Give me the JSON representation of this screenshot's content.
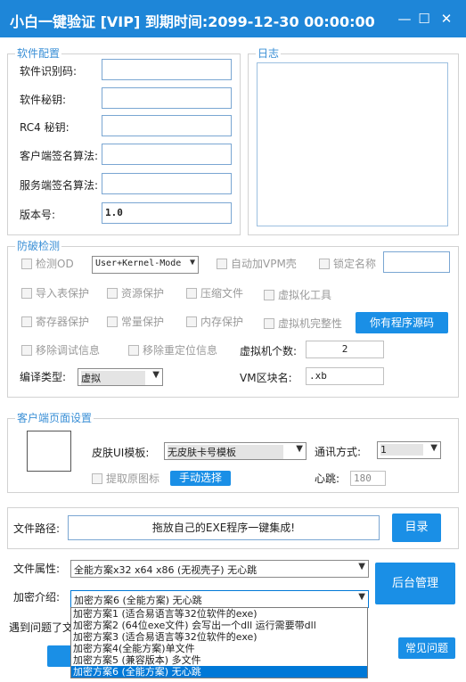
{
  "window": {
    "title": "小白一键验证 [VIP]  到期时间:2099-12-30 00:00:00",
    "minimize_glyph": "—",
    "maximize_glyph": "☐",
    "close_glyph": "✕"
  },
  "software_config": {
    "legend": "软件配置",
    "fields": [
      {
        "label": "软件识别码:",
        "value": ""
      },
      {
        "label": "软件秘钥:",
        "value": ""
      },
      {
        "label": "RC4 秘钥:",
        "value": ""
      },
      {
        "label": "客户端签名算法:",
        "value": ""
      },
      {
        "label": "服务端签名算法:",
        "value": ""
      },
      {
        "label": "版本号:",
        "value": "1.0"
      }
    ]
  },
  "log": {
    "legend": "日志"
  },
  "protection": {
    "legend": "防破检测",
    "detect_od": "检测OD",
    "mode_select": "User+Kernel-Mode",
    "auto_vmp": "自动加VPM壳",
    "lock_name": "锁定名称",
    "lock_name_value": "",
    "import_protect": "导入表保护",
    "resource_protect": "资源保护",
    "compress_file": "压缩文件",
    "virtualize_tool": "虚拟化工具",
    "register_protect": "寄存器保护",
    "constant_protect": "常量保护",
    "memory_protect": "内存保护",
    "vm_integrity": "虚拟机完整性",
    "source_button": "你有程序源码",
    "remove_debug": "移除调试信息",
    "remove_reloc": "移除重定位信息",
    "vm_count_label": "虚拟机个数:",
    "vm_count_value": "2",
    "compile_type_label": "编译类型:",
    "compile_type_value": "虚拟",
    "vm_section_label": "VM区块名:",
    "vm_section_value": ".xb"
  },
  "client_ui": {
    "legend": "客户端页面设置",
    "skin_label": "皮肤UI模板:",
    "skin_value": "无皮肤卡号模板",
    "comm_label": "通讯方式:",
    "comm_value": "1",
    "extract_icon": "提取原图标",
    "manual_select": "手动选择",
    "heartbeat_label": "心跳:",
    "heartbeat_value": "180"
  },
  "file_path": {
    "label": "文件路径:",
    "placeholder": "拖放自己的EXE程序一键集成!",
    "dir_button": "目录"
  },
  "file_attr": {
    "label": "文件属性:",
    "value": "全能方案x32 x64 x86 (无视壳子) 无心跳"
  },
  "encryption": {
    "label": "加密介绍:",
    "value": "加密方案6 (全能方案) 无心跳",
    "options": [
      "加密方案1 (适合易语言等32位软件的exe)",
      "加密方案2 (64位exe文件) 会写出一个dll 运行需要带dll",
      "加密方案3 (适合易语言等32位软件的exe)",
      "加密方案4(全能方案)单文件",
      "加密方案5 (兼容版本) 多文件",
      "加密方案6 (全能方案) 无心跳"
    ]
  },
  "backend_button": "后台管理",
  "problem_text": "遇到问题了文",
  "faq_button": "常见问题",
  "colors": {
    "accent": "#1e86d8",
    "button": "#1a8fe6",
    "legend": "#3a8fd6"
  }
}
